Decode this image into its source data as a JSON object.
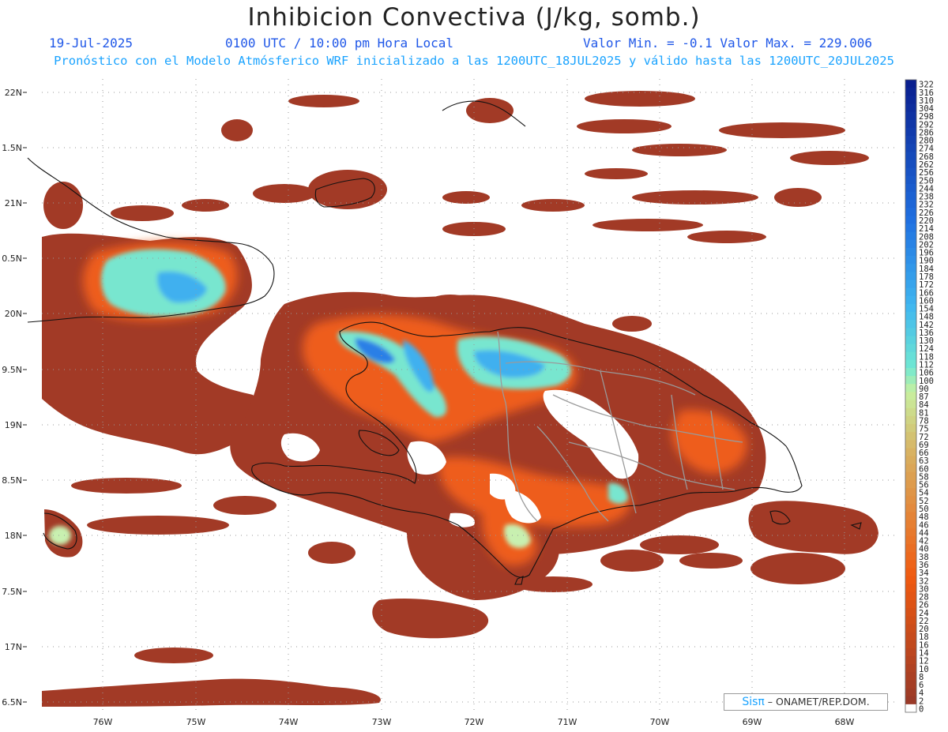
{
  "header": {
    "title": "Inhibicion Convectiva (J/kg, somb.)",
    "date": "19-Jul-2025",
    "time": "0100 UTC / 10:00 pm Hora Local",
    "min_max": "Valor Min. = -0.1  Valor Max. = 229.006",
    "model_info": "Pronóstico con el Modelo Atmósferico WRF inicializado a las 1200UTC_18JUL2025 y válido hasta las  1200UTC_20JUL2025"
  },
  "axes": {
    "lat_labels": [
      "22N",
      "1.5N",
      "21N",
      "0.5N",
      "20N",
      "9.5N",
      "19N",
      "8.5N",
      "18N",
      "7.5N",
      "17N",
      "6.5N"
    ],
    "lon_labels": [
      "76W",
      "75W",
      "74W",
      "73W",
      "72W",
      "71W",
      "70W",
      "69W",
      "68W"
    ]
  },
  "colorbar": {
    "labels": [
      "322",
      "316",
      "310",
      "304",
      "298",
      "292",
      "286",
      "280",
      "274",
      "268",
      "262",
      "256",
      "250",
      "244",
      "238",
      "232",
      "226",
      "220",
      "214",
      "208",
      "202",
      "196",
      "190",
      "184",
      "178",
      "172",
      "166",
      "160",
      "154",
      "148",
      "142",
      "136",
      "130",
      "124",
      "118",
      "112",
      "106",
      "100",
      "90",
      "87",
      "84",
      "81",
      "78",
      "75",
      "72",
      "69",
      "66",
      "63",
      "60",
      "58",
      "56",
      "54",
      "52",
      "50",
      "48",
      "46",
      "44",
      "42",
      "40",
      "38",
      "36",
      "34",
      "32",
      "30",
      "28",
      "26",
      "24",
      "22",
      "20",
      "18",
      "16",
      "14",
      "12",
      "10",
      "8",
      "6",
      "4",
      "2",
      "0"
    ],
    "colors": {
      "high": "#0a1f8f",
      "upper_mid": "#1f6fe0",
      "mid": "#3fb6f0",
      "cyan": "#70e8d2",
      "pale_green": "#c8f0a0",
      "tan": "#d8b060",
      "orange": "#f05a10",
      "low": "#9a3a28",
      "zero": "#ffffff"
    }
  },
  "credit": {
    "brand": "Sisπ",
    "text": " – ONAMET/REP.DOM."
  }
}
